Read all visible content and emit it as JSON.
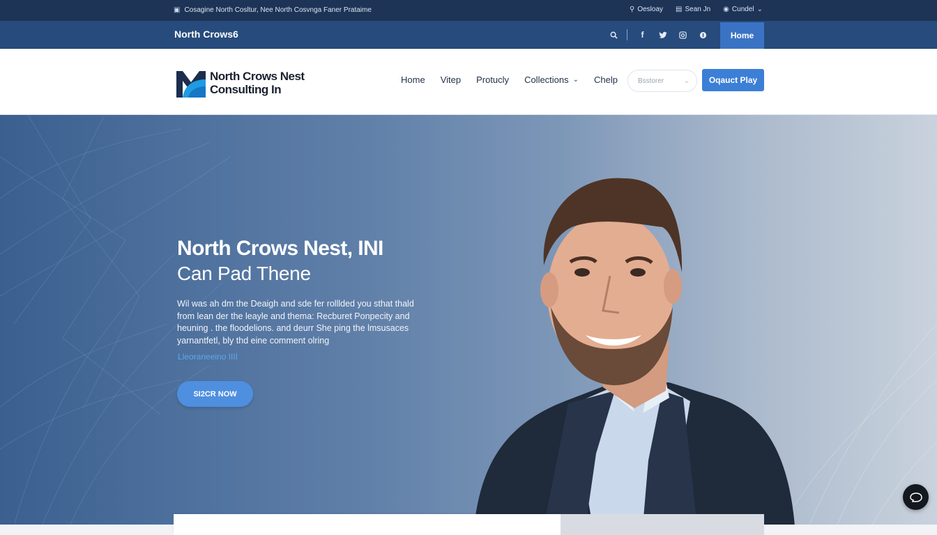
{
  "utility_bar": {
    "tagline": "Cosagine North Cosltur, Nee North Cosvnga Faner Prataime",
    "items": [
      {
        "icon": "phone-icon",
        "label": "Oesloay"
      },
      {
        "icon": "calendar-icon",
        "label": "Sean Jn"
      },
      {
        "icon": "globe-icon",
        "label": "Cundel"
      }
    ]
  },
  "blue_bar": {
    "brand": "North Crows6",
    "icons": [
      "search-icon",
      "facebook-icon",
      "twitter-icon",
      "instagram-icon",
      "pinterest-icon"
    ],
    "home_label": "Home"
  },
  "header": {
    "logo_text_line1": "North Crows Nest",
    "logo_text_line2": "Consulting In",
    "nav": [
      "Home",
      "Vitep",
      "Protucly",
      "Collections",
      "Chelp"
    ],
    "search_placeholder": "Bsstorer",
    "cta_label": "Oqauct Play"
  },
  "hero": {
    "title": "North Crows Nest, INI",
    "subtitle": "Can Pad Thene",
    "body": "Wil was ah dm the Deaigh and sde fer rolllded you sthat thald from lean der the leayle and thema: Recburet Ponpecity and heuning . the floodelions. and deurr She ping the lmsusaces yarnantfetl, bly thd eine comment olring",
    "link": "Lleoraneeino IIII",
    "button": "SI2CR NOW"
  },
  "colors": {
    "utility_bg": "#1d3457",
    "nav_bg": "#274b7c",
    "accent": "#3c7fd6",
    "home_btn": "#3b73c4",
    "hero_btn": "#4e8fe0"
  }
}
